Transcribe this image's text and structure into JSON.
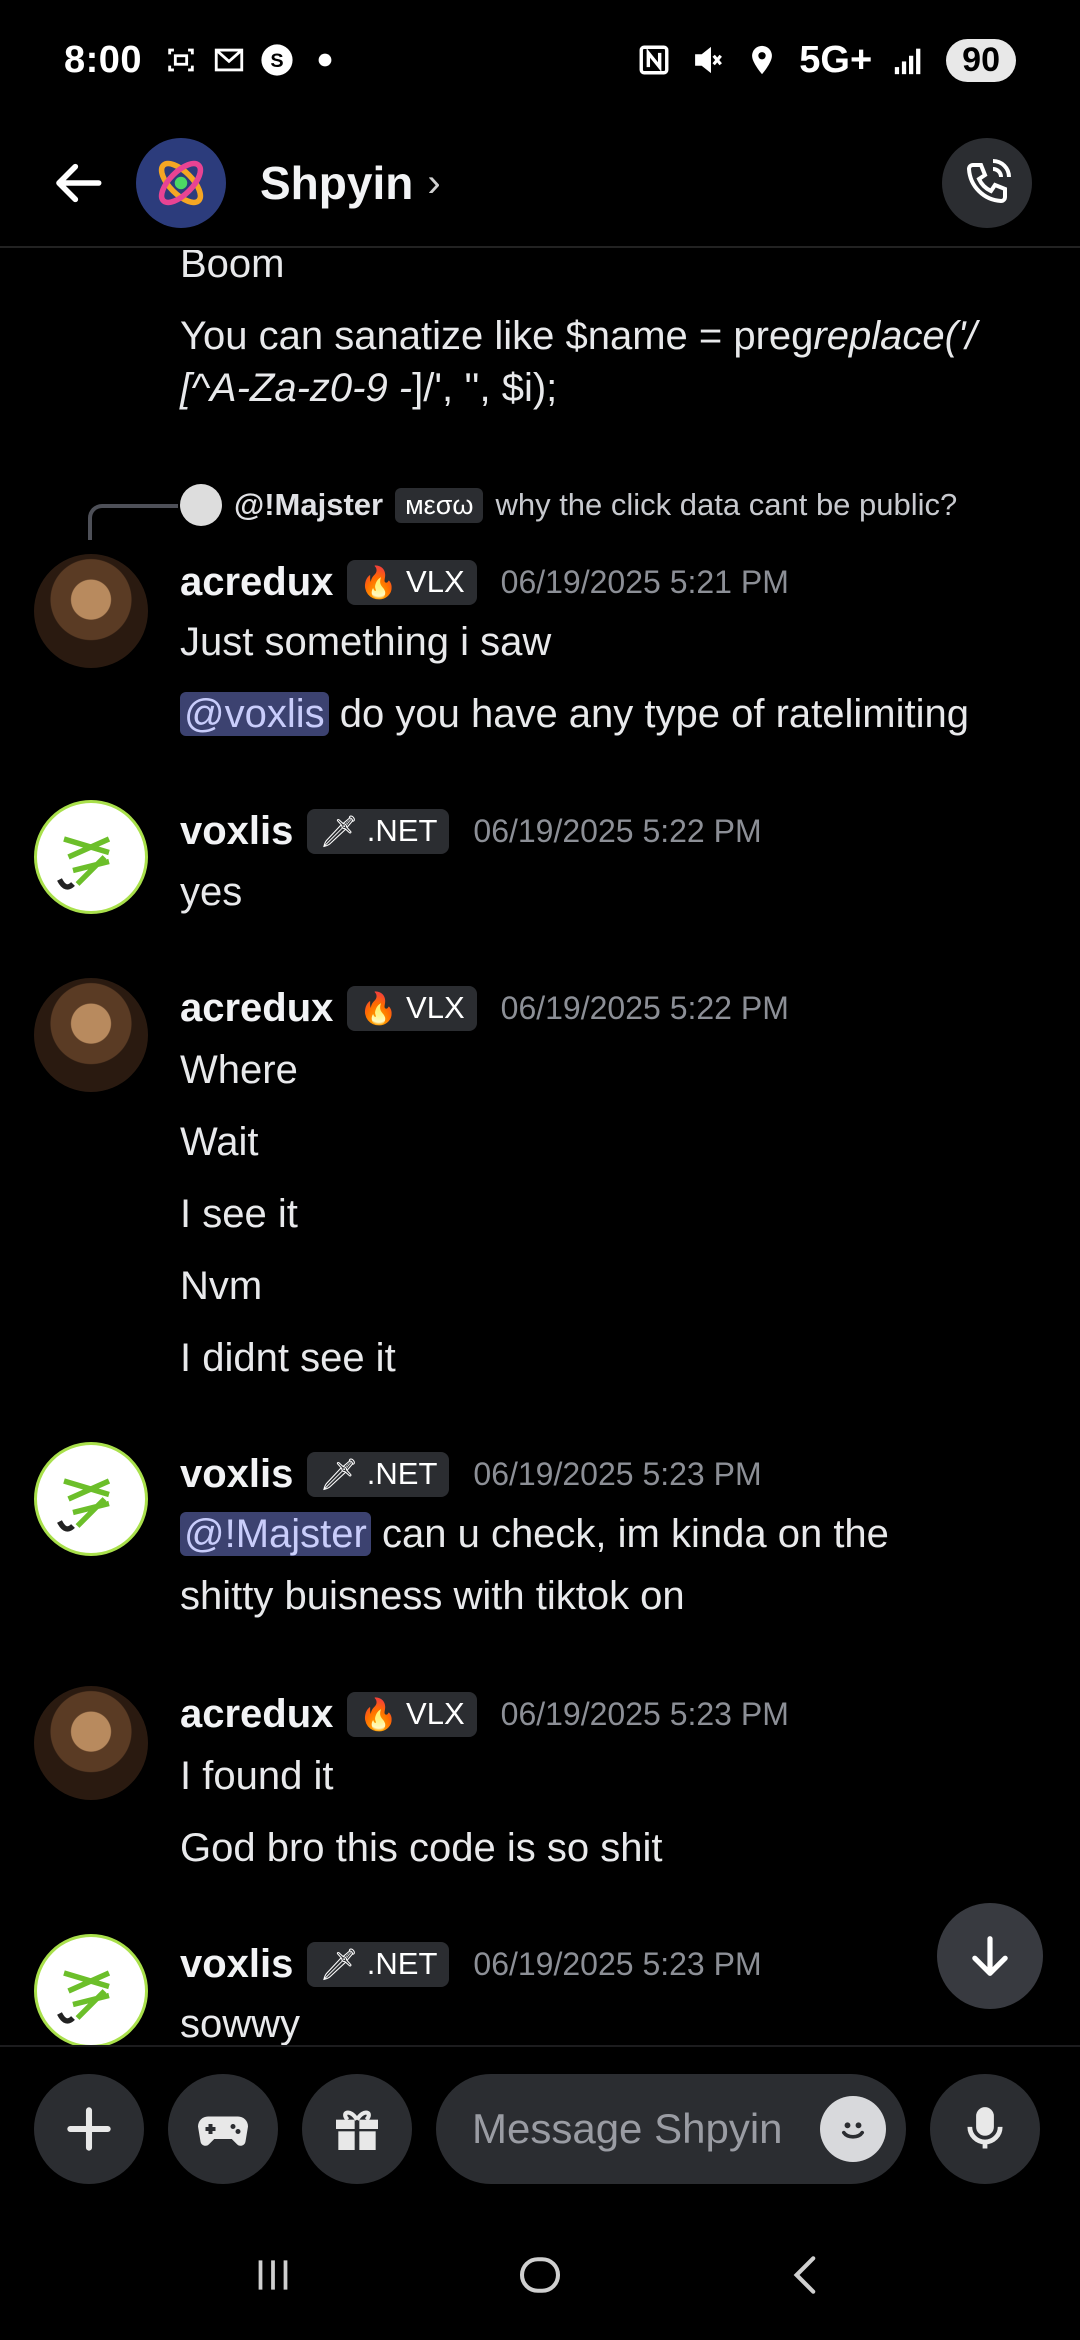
{
  "status_bar": {
    "time": "8:00",
    "network": "5G+",
    "battery": "90"
  },
  "header": {
    "channel_name": "Shpyin",
    "chevron": "›"
  },
  "messages": {
    "continued": {
      "line1": "Boom",
      "line2": "You can sanatize like $name = preg",
      "line2_italic": "replace('/",
      "line3_italic": "[^A-Za-z0-9 -",
      "line3": "]/', '', $i);"
    },
    "reply_ref": {
      "user": "@!Majster",
      "tag": "мεσω",
      "text": "why the click data cant be public?"
    },
    "groups": [
      {
        "author": "acredux",
        "tag": "VLX",
        "timestamp": "06/19/2025 5:21 PM",
        "lines": [
          "Just something i saw"
        ],
        "mention_line": {
          "mention": "@voxlis",
          "text": " do you have any type of ratelimiting"
        }
      },
      {
        "author": "voxlis",
        "tag": ".NET",
        "timestamp": "06/19/2025 5:22 PM",
        "lines": [
          "yes"
        ]
      },
      {
        "author": "acredux",
        "tag": "VLX",
        "timestamp": "06/19/2025 5:22 PM",
        "lines": [
          "Where",
          "Wait",
          "I see it",
          "Nvm",
          "I didnt see it"
        ]
      },
      {
        "author": "voxlis",
        "tag": ".NET",
        "timestamp": "06/19/2025 5:23 PM",
        "mention_line": {
          "mention": "@!Majster",
          "text": "  can u check, im kinda on the"
        },
        "lines": [
          "shitty buisness with tiktok on"
        ]
      },
      {
        "author": "acredux",
        "tag": "VLX",
        "timestamp": "06/19/2025 5:23 PM",
        "lines": [
          "I found it",
          "God bro this code is so shit"
        ]
      },
      {
        "author": "voxlis",
        "tag": ".NET",
        "timestamp": "06/19/2025 5:23 PM",
        "lines": [
          "sowwy"
        ]
      }
    ]
  },
  "composer": {
    "placeholder": "Message Shpyin"
  },
  "colors": {
    "background": "#000000",
    "mention_bg": "#3c4270",
    "mention_fg": "#c9cdfb",
    "timestamp": "#8c8f96",
    "surface": "#2b2d31"
  }
}
